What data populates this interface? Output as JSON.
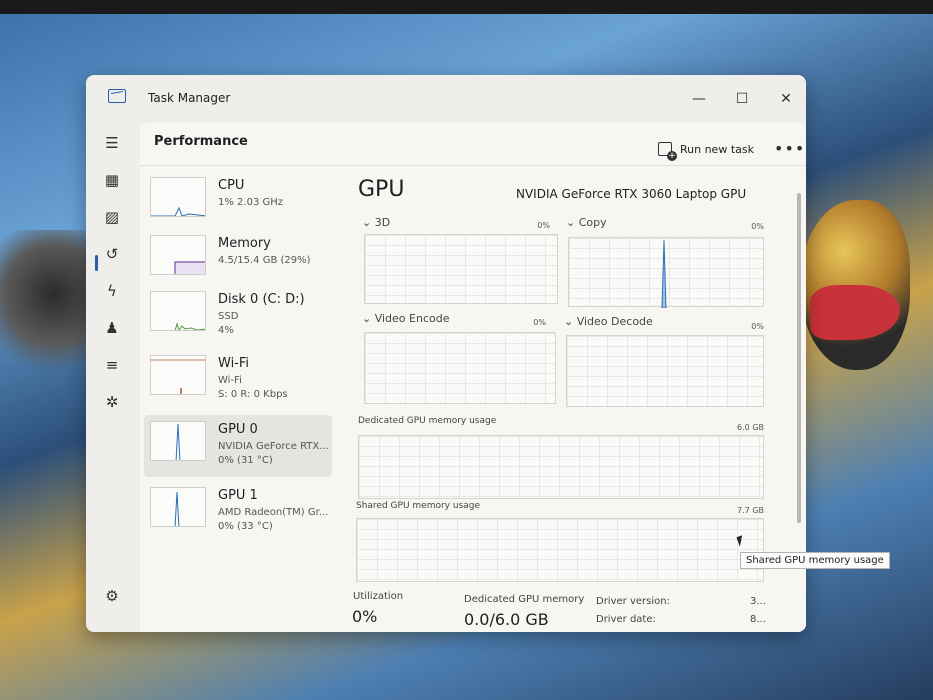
{
  "window": {
    "title": "Task Manager",
    "minimize": "—",
    "maximize": "☐",
    "close": "✕"
  },
  "nav": {
    "items": [
      {
        "icon": "hamburger-icon",
        "glyph": "☰"
      },
      {
        "icon": "processes-icon",
        "glyph": "▦"
      },
      {
        "icon": "performance-icon",
        "glyph": "▨"
      },
      {
        "icon": "app-history-icon",
        "glyph": "↺"
      },
      {
        "icon": "startup-apps-icon",
        "glyph": "ϟ"
      },
      {
        "icon": "users-icon",
        "glyph": "♟"
      },
      {
        "icon": "details-icon",
        "glyph": "≡"
      },
      {
        "icon": "services-icon",
        "glyph": "✲"
      }
    ],
    "settings": {
      "icon": "settings-icon",
      "glyph": "⚙"
    }
  },
  "header": {
    "title": "Performance",
    "run_new_task": "Run new task",
    "more": "•••"
  },
  "devices": [
    {
      "name": "CPU",
      "sub1": "1% 2.03 GHz",
      "sub2": ""
    },
    {
      "name": "Memory",
      "sub1": "4.5/15.4 GB (29%)",
      "sub2": ""
    },
    {
      "name": "Disk 0 (C: D:)",
      "sub1": "SSD",
      "sub2": "4%"
    },
    {
      "name": "Wi-Fi",
      "sub1": "Wi-Fi",
      "sub2": "S: 0 R: 0 Kbps"
    },
    {
      "name": "GPU 0",
      "sub1": "NVIDIA GeForce RTX...",
      "sub2": "0% (31 °C)"
    },
    {
      "name": "GPU 1",
      "sub1": "AMD Radeon(TM) Gr...",
      "sub2": "0% (33 °C)"
    }
  ],
  "detail": {
    "title": "GPU",
    "model": "NVIDIA GeForce RTX 3060 Laptop GPU",
    "engines": [
      {
        "label": "3D",
        "pct": "0%"
      },
      {
        "label": "Copy",
        "pct": "0%"
      },
      {
        "label": "Video Encode",
        "pct": "0%"
      },
      {
        "label": "Video Decode",
        "pct": "0%"
      }
    ],
    "dedicated_label": "Dedicated GPU memory usage",
    "dedicated_max": "6.0 GB",
    "shared_label": "Shared GPU memory usage",
    "shared_max": "7.7 GB",
    "stats": {
      "utilization_label": "Utilization",
      "utilization_value": "0%",
      "dedicated_mem_label": "Dedicated GPU memory",
      "dedicated_mem_value": "0.0/6.0 GB",
      "driver_version_label": "Driver version:",
      "driver_version_value": "3...",
      "driver_date_label": "Driver date:",
      "driver_date_value": "8..."
    }
  },
  "tooltip": "Shared GPU memory usage"
}
